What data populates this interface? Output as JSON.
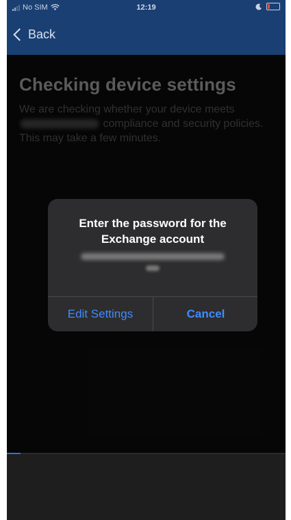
{
  "status_bar": {
    "carrier": "No SIM",
    "time": "12:19",
    "icons": [
      "signal-icon",
      "wifi-icon",
      "moon-icon",
      "battery-icon"
    ]
  },
  "nav": {
    "back_label": "Back"
  },
  "page": {
    "title": "Checking device settings",
    "description_part1": "We are checking whether your device meets",
    "description_part2": "compliance and security policies. This may take a few minutes."
  },
  "alert": {
    "title": "Enter the password for the Exchange account",
    "edit_settings_label": "Edit Settings",
    "cancel_label": "Cancel"
  },
  "progress": {
    "fraction": 0.05
  },
  "colors": {
    "nav_bar": "#1a3f73",
    "background": "#0a0a0a",
    "alert_bg": "#2d2d2f",
    "alert_button": "#3f8cff",
    "progress": "#2f6fe0"
  }
}
